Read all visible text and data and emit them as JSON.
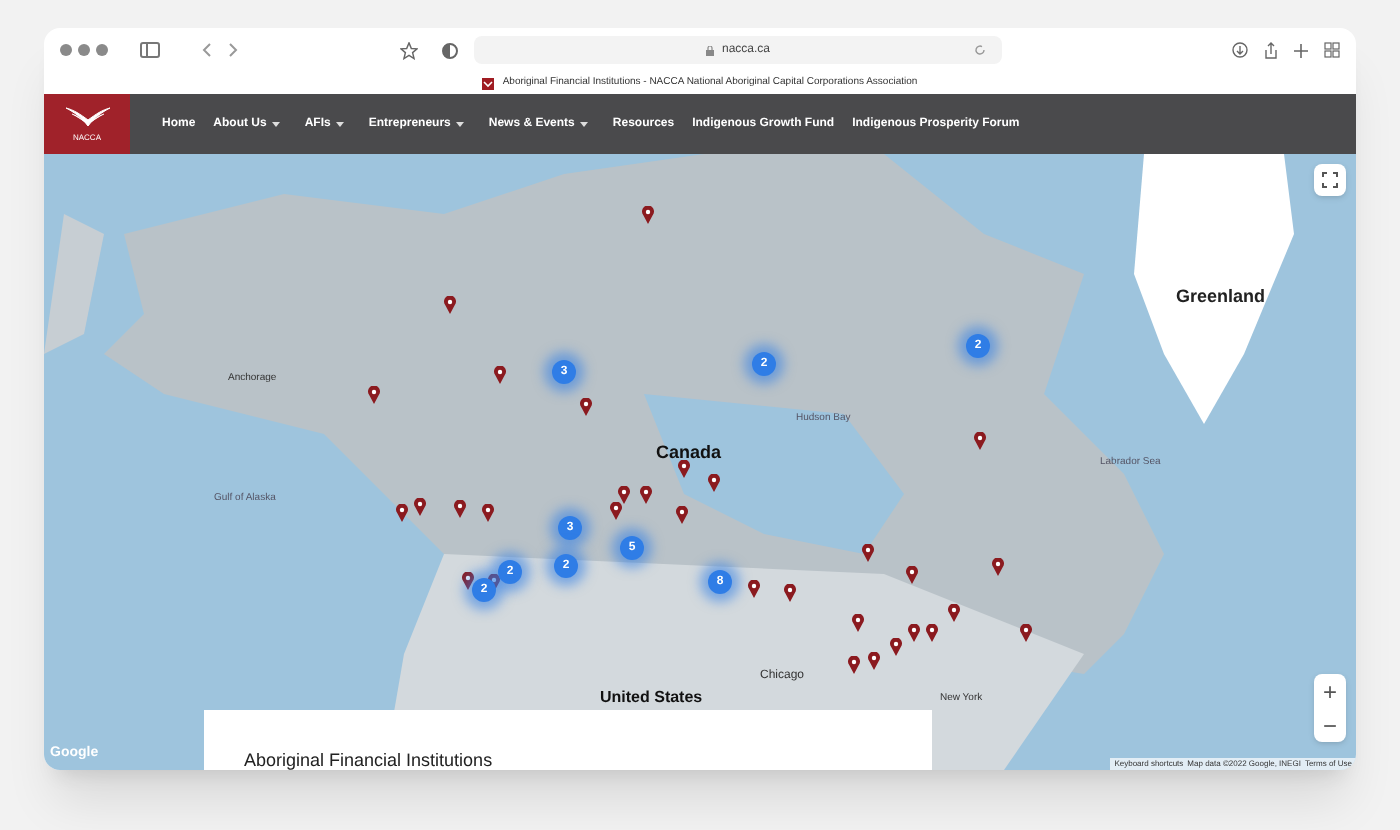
{
  "browser": {
    "url": "nacca.ca",
    "tab_title": "Aboriginal Financial Institutions - NACCA National Aboriginal Capital Corporations Association"
  },
  "site": {
    "logo_text": "NACCA",
    "nav": [
      {
        "label": "Home",
        "dropdown": false
      },
      {
        "label": "About Us",
        "dropdown": true
      },
      {
        "label": "AFIs",
        "dropdown": true
      },
      {
        "label": "Entrepreneurs",
        "dropdown": true
      },
      {
        "label": "News & Events",
        "dropdown": true
      },
      {
        "label": "Resources",
        "dropdown": false
      },
      {
        "label": "Indigenous Growth Fund",
        "dropdown": false
      },
      {
        "label": "Indigenous Prosperity Forum",
        "dropdown": false
      }
    ]
  },
  "map": {
    "labels": [
      "Greenland",
      "Canada",
      "United States",
      "Hudson Bay",
      "Labrador Sea",
      "Chicago",
      "New York",
      "Anchorage",
      "Gulf of Alaska"
    ],
    "clusters": [
      "3",
      "2",
      "2",
      "3",
      "5",
      "2",
      "2",
      "2",
      "8"
    ],
    "attribution": {
      "logo": "Google",
      "shortcuts": "Keyboard shortcuts",
      "data": "Map data ©2022 Google, INEGI",
      "terms": "Terms of Use"
    },
    "zoom_in": "+",
    "zoom_out": "−"
  },
  "card": {
    "title": "Aboriginal Financial Institutions"
  }
}
